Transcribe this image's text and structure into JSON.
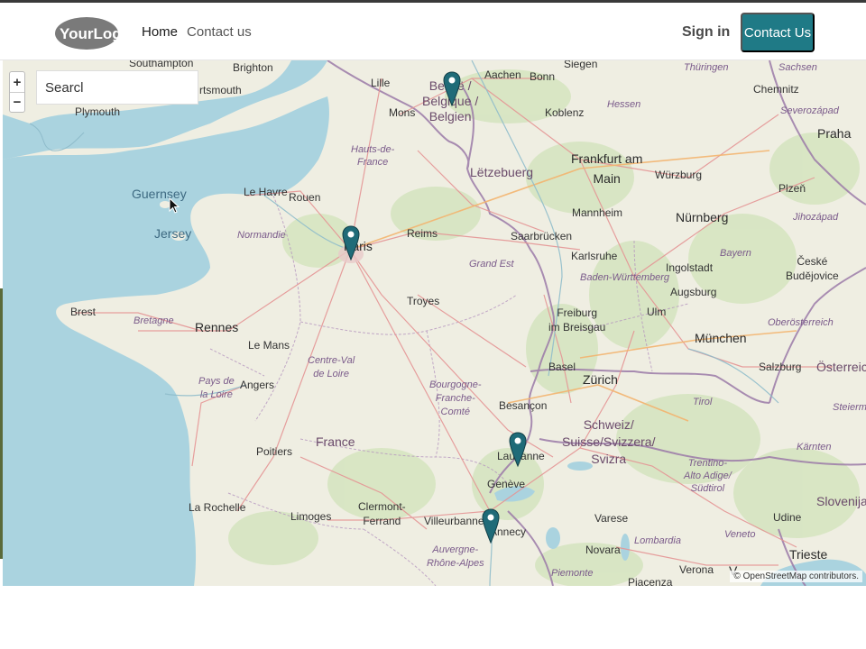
{
  "header": {
    "logo_text": "YourLogo",
    "nav": {
      "home": "Home",
      "contact": "Contact us"
    },
    "signin": "Sign in",
    "cta": "Contact Us"
  },
  "map": {
    "zoom_in": "+",
    "zoom_out": "−",
    "search_value": "Searcl",
    "attribution": "© OpenStreetMap contributors.",
    "colors": {
      "sea": "#aad3df",
      "land": "#f0efe2",
      "forest": "#cfe3b8",
      "road": "#e8a0a0",
      "border": "#9b7aa8",
      "marker": "#1f6b78"
    },
    "labels": {
      "brighton": "Brighton",
      "portsmouth": "rtsmouth",
      "southampton": "Southampton",
      "plymouth": "Plymouth",
      "lille": "Lille",
      "mons": "Mons",
      "belgique": "België /\nBelgique /\nBelgien",
      "aachen": "Aachen",
      "bonn": "Bonn",
      "siegen": "Siegen",
      "thuringen": "Thüringen",
      "sachsen": "Sachsen",
      "chemnitz": "Chemnitz",
      "koblenz": "Koblenz",
      "hessen": "Hessen",
      "severozapad": "Severozápad",
      "praha": "Praha",
      "hauts": "Hauts-de-\nFrance",
      "letzebuerg": "Lëtzebuerg",
      "frankfurt": "Frankfurt am\nMain",
      "wurzburg": "Würzburg",
      "plzen": "Plzeň",
      "guernsey": "Guernsey",
      "jersey": "Jersey",
      "lehavre": "Le Havre",
      "rouen": "Rouen",
      "normandie": "Normandie",
      "paris": "Paris",
      "reims": "Reims",
      "saarbrucken": "Saarbrücken",
      "mannheim": "Mannheim",
      "nurnberg": "Nürnberg",
      "jihozapad": "Jihozápad",
      "karlsruhe": "Karlsruhe",
      "bayern": "Bayern",
      "grandest": "Grand Est",
      "baden": "Baden-Württemberg",
      "ingolstadt": "Ingolstadt",
      "ceske": "České\nBudějovice",
      "augsburg": "Augsburg",
      "brest": "Brest",
      "bretagne": "Bretagne",
      "troyes": "Troyes",
      "rennes": "Rennes",
      "freiburg": "Freiburg\nim Breisgau",
      "ulm": "Ulm",
      "munchen": "München",
      "oberosterreich": "Oberösterreich",
      "lemans": "Le Mans",
      "centreval": "Centre-Val\nde Loire",
      "basel": "Basel",
      "zurich": "Zürich",
      "salzburg": "Salzburg",
      "osterreich": "Österreich",
      "paysloire": "Pays de\nla Loire",
      "angers": "Angers",
      "bourgogne": "Bourgogne-\nFranche-\nComté",
      "besancon": "Besançon",
      "tirol": "Tirol",
      "steiermark": "Steierma",
      "schweiz": "Schweiz/\nSuisse/Svizzera/\nSvizra",
      "france": "France",
      "poitiers": "Poitiers",
      "lausanne": "Lausanne",
      "karnten": "Kärnten",
      "trentino": "Trentino-\nAlto Adige/\nSüdtirol",
      "geneve": "Genève",
      "slovenija": "Slovenija",
      "udine": "Udine",
      "larochelle": "La Rochelle",
      "limoges": "Limoges",
      "clermont": "Clermont-\nFerrand",
      "villeurbanne": "Villeurbanne",
      "annecy": "Annecy",
      "varese": "Varese",
      "veneto": "Veneto",
      "trieste": "Trieste",
      "auvergne": "Auvergne-\nRhône-Alpes",
      "lombardia": "Lombardia",
      "novara": "Novara",
      "verona": "Verona",
      "piemonte": "Piemonte",
      "piacenza": "Piacenza",
      "venezia": "V"
    }
  }
}
